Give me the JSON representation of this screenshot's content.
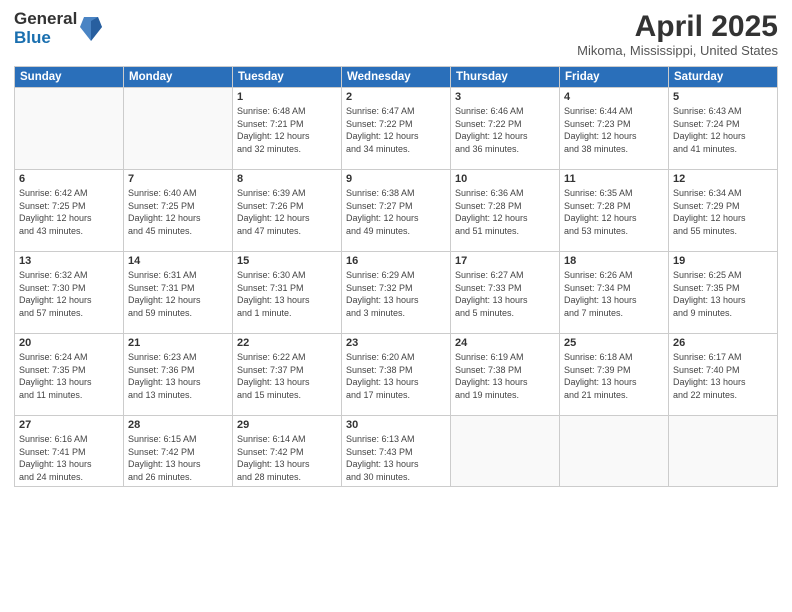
{
  "logo": {
    "general": "General",
    "blue": "Blue"
  },
  "header": {
    "month": "April 2025",
    "location": "Mikoma, Mississippi, United States"
  },
  "weekdays": [
    "Sunday",
    "Monday",
    "Tuesday",
    "Wednesday",
    "Thursday",
    "Friday",
    "Saturday"
  ],
  "weeks": [
    [
      {
        "day": "",
        "info": ""
      },
      {
        "day": "",
        "info": ""
      },
      {
        "day": "1",
        "info": "Sunrise: 6:48 AM\nSunset: 7:21 PM\nDaylight: 12 hours\nand 32 minutes."
      },
      {
        "day": "2",
        "info": "Sunrise: 6:47 AM\nSunset: 7:22 PM\nDaylight: 12 hours\nand 34 minutes."
      },
      {
        "day": "3",
        "info": "Sunrise: 6:46 AM\nSunset: 7:22 PM\nDaylight: 12 hours\nand 36 minutes."
      },
      {
        "day": "4",
        "info": "Sunrise: 6:44 AM\nSunset: 7:23 PM\nDaylight: 12 hours\nand 38 minutes."
      },
      {
        "day": "5",
        "info": "Sunrise: 6:43 AM\nSunset: 7:24 PM\nDaylight: 12 hours\nand 41 minutes."
      }
    ],
    [
      {
        "day": "6",
        "info": "Sunrise: 6:42 AM\nSunset: 7:25 PM\nDaylight: 12 hours\nand 43 minutes."
      },
      {
        "day": "7",
        "info": "Sunrise: 6:40 AM\nSunset: 7:25 PM\nDaylight: 12 hours\nand 45 minutes."
      },
      {
        "day": "8",
        "info": "Sunrise: 6:39 AM\nSunset: 7:26 PM\nDaylight: 12 hours\nand 47 minutes."
      },
      {
        "day": "9",
        "info": "Sunrise: 6:38 AM\nSunset: 7:27 PM\nDaylight: 12 hours\nand 49 minutes."
      },
      {
        "day": "10",
        "info": "Sunrise: 6:36 AM\nSunset: 7:28 PM\nDaylight: 12 hours\nand 51 minutes."
      },
      {
        "day": "11",
        "info": "Sunrise: 6:35 AM\nSunset: 7:28 PM\nDaylight: 12 hours\nand 53 minutes."
      },
      {
        "day": "12",
        "info": "Sunrise: 6:34 AM\nSunset: 7:29 PM\nDaylight: 12 hours\nand 55 minutes."
      }
    ],
    [
      {
        "day": "13",
        "info": "Sunrise: 6:32 AM\nSunset: 7:30 PM\nDaylight: 12 hours\nand 57 minutes."
      },
      {
        "day": "14",
        "info": "Sunrise: 6:31 AM\nSunset: 7:31 PM\nDaylight: 12 hours\nand 59 minutes."
      },
      {
        "day": "15",
        "info": "Sunrise: 6:30 AM\nSunset: 7:31 PM\nDaylight: 13 hours\nand 1 minute."
      },
      {
        "day": "16",
        "info": "Sunrise: 6:29 AM\nSunset: 7:32 PM\nDaylight: 13 hours\nand 3 minutes."
      },
      {
        "day": "17",
        "info": "Sunrise: 6:27 AM\nSunset: 7:33 PM\nDaylight: 13 hours\nand 5 minutes."
      },
      {
        "day": "18",
        "info": "Sunrise: 6:26 AM\nSunset: 7:34 PM\nDaylight: 13 hours\nand 7 minutes."
      },
      {
        "day": "19",
        "info": "Sunrise: 6:25 AM\nSunset: 7:35 PM\nDaylight: 13 hours\nand 9 minutes."
      }
    ],
    [
      {
        "day": "20",
        "info": "Sunrise: 6:24 AM\nSunset: 7:35 PM\nDaylight: 13 hours\nand 11 minutes."
      },
      {
        "day": "21",
        "info": "Sunrise: 6:23 AM\nSunset: 7:36 PM\nDaylight: 13 hours\nand 13 minutes."
      },
      {
        "day": "22",
        "info": "Sunrise: 6:22 AM\nSunset: 7:37 PM\nDaylight: 13 hours\nand 15 minutes."
      },
      {
        "day": "23",
        "info": "Sunrise: 6:20 AM\nSunset: 7:38 PM\nDaylight: 13 hours\nand 17 minutes."
      },
      {
        "day": "24",
        "info": "Sunrise: 6:19 AM\nSunset: 7:38 PM\nDaylight: 13 hours\nand 19 minutes."
      },
      {
        "day": "25",
        "info": "Sunrise: 6:18 AM\nSunset: 7:39 PM\nDaylight: 13 hours\nand 21 minutes."
      },
      {
        "day": "26",
        "info": "Sunrise: 6:17 AM\nSunset: 7:40 PM\nDaylight: 13 hours\nand 22 minutes."
      }
    ],
    [
      {
        "day": "27",
        "info": "Sunrise: 6:16 AM\nSunset: 7:41 PM\nDaylight: 13 hours\nand 24 minutes."
      },
      {
        "day": "28",
        "info": "Sunrise: 6:15 AM\nSunset: 7:42 PM\nDaylight: 13 hours\nand 26 minutes."
      },
      {
        "day": "29",
        "info": "Sunrise: 6:14 AM\nSunset: 7:42 PM\nDaylight: 13 hours\nand 28 minutes."
      },
      {
        "day": "30",
        "info": "Sunrise: 6:13 AM\nSunset: 7:43 PM\nDaylight: 13 hours\nand 30 minutes."
      },
      {
        "day": "",
        "info": ""
      },
      {
        "day": "",
        "info": ""
      },
      {
        "day": "",
        "info": ""
      }
    ]
  ]
}
